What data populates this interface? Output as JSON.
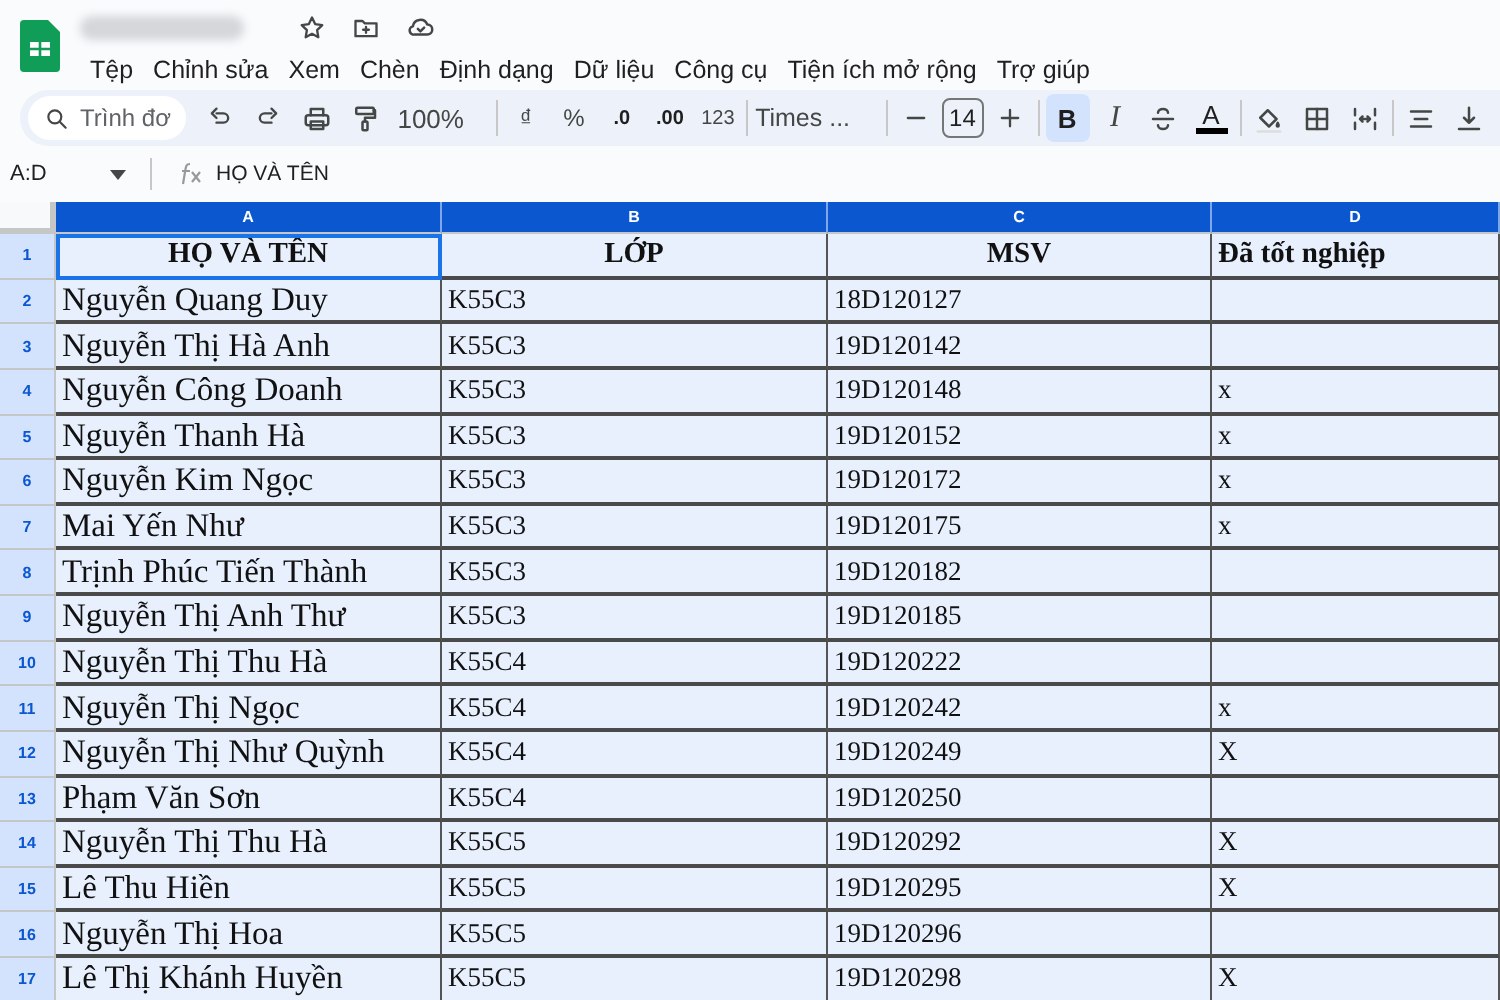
{
  "menus": [
    "Tệp",
    "Chỉnh sửa",
    "Xem",
    "Chèn",
    "Định dạng",
    "Dữ liệu",
    "Công cụ",
    "Tiện ích mở rộng",
    "Trợ giúp"
  ],
  "toolbar": {
    "search_placeholder": "Trình đơ",
    "zoom": "100%",
    "currency": "₫",
    "percent": "%",
    "decrease_decimal": ".0",
    "increase_decimal": ".00",
    "number_format": "123",
    "font": "Times ...",
    "font_size": "14",
    "bold": {
      "label": "B",
      "selected": true
    },
    "italic": {
      "label": "I",
      "selected": false
    },
    "text_color": "A"
  },
  "formula_bar": {
    "name_box": "A:D",
    "content": "HỌ VÀ TÊN"
  },
  "columns": [
    {
      "label": "A",
      "selected": true
    },
    {
      "label": "B",
      "selected": true
    },
    {
      "label": "C",
      "selected": true
    },
    {
      "label": "D",
      "selected": true
    }
  ],
  "rows": [
    {
      "number": "1",
      "kind": "header",
      "cells": [
        "HỌ VÀ TÊN",
        "LỚP",
        "MSV",
        "Đã tốt nghiệp"
      ]
    },
    {
      "number": "2",
      "kind": "data",
      "cells": [
        "Nguyễn Quang Duy",
        "K55C3",
        "18D120127",
        null
      ]
    },
    {
      "number": "3",
      "kind": "data",
      "cells": [
        "Nguyễn Thị Hà Anh",
        "K55C3",
        "19D120142",
        null
      ]
    },
    {
      "number": "4",
      "kind": "data",
      "cells": [
        "Nguyễn Công Doanh",
        "K55C3",
        "19D120148",
        "x"
      ]
    },
    {
      "number": "5",
      "kind": "data",
      "cells": [
        "Nguyễn Thanh Hà",
        "K55C3",
        "19D120152",
        "x"
      ]
    },
    {
      "number": "6",
      "kind": "data",
      "cells": [
        "Nguyễn Kim Ngọc",
        "K55C3",
        "19D120172",
        "x"
      ]
    },
    {
      "number": "7",
      "kind": "data",
      "cells": [
        "Mai Yến Như",
        "K55C3",
        "19D120175",
        "x"
      ]
    },
    {
      "number": "8",
      "kind": "data",
      "cells": [
        "Trịnh Phúc Tiến Thành",
        "K55C3",
        "19D120182",
        null
      ]
    },
    {
      "number": "9",
      "kind": "data",
      "cells": [
        "Nguyễn Thị Anh Thư",
        "K55C3",
        "19D120185",
        null
      ]
    },
    {
      "number": "10",
      "kind": "data",
      "cells": [
        "Nguyễn Thị Thu Hà",
        "K55C4",
        "19D120222",
        null
      ]
    },
    {
      "number": "11",
      "kind": "data",
      "cells": [
        "Nguyễn Thị Ngọc",
        "K55C4",
        "19D120242",
        "x"
      ]
    },
    {
      "number": "12",
      "kind": "data",
      "cells": [
        "Nguyễn Thị Như Quỳnh",
        "K55C4",
        "19D120249",
        "X"
      ]
    },
    {
      "number": "13",
      "kind": "data",
      "cells": [
        "Phạm Văn Sơn",
        "K55C4",
        "19D120250",
        null
      ]
    },
    {
      "number": "14",
      "kind": "data",
      "cells": [
        "Nguyễn Thị Thu Hà",
        "K55C5",
        "19D120292",
        "X"
      ]
    },
    {
      "number": "15",
      "kind": "data",
      "cells": [
        "Lê Thu Hiền",
        "K55C5",
        "19D120295",
        "X"
      ]
    },
    {
      "number": "16",
      "kind": "data",
      "cells": [
        "Nguyễn Thị Hoa",
        "K55C5",
        "19D120296",
        null
      ]
    },
    {
      "number": "17",
      "kind": "data",
      "cells": [
        "Lê Thị Khánh Huyền",
        "K55C5",
        "19D120298",
        "X"
      ]
    }
  ]
}
